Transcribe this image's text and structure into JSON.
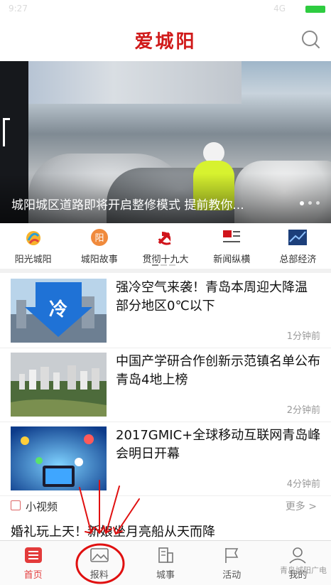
{
  "status_bar": {
    "time": "9:27",
    "network": "4G"
  },
  "header": {
    "title": "爱城阳"
  },
  "banner": {
    "caption": "城阳城区道路即将开启整修模式 提前教你...",
    "dots": 3,
    "active_dot": 0
  },
  "categories": [
    {
      "label": "阳光城阳",
      "icon": "sunshine-logo-icon"
    },
    {
      "label": "城阳故事",
      "icon": "story-badge-icon"
    },
    {
      "label": "贯彻十九大",
      "icon": "party-emblem-icon"
    },
    {
      "label": "新闻纵横",
      "icon": "news-flag-icon"
    },
    {
      "label": "总部经济",
      "icon": "economy-logo-icon"
    }
  ],
  "news": [
    {
      "title": "强冷空气来袭！青岛本周迎大降温 部分地区0℃以下",
      "time": "1分钟前",
      "thumb_text": "冷"
    },
    {
      "title": "中国产学研合作创新示范镇名单公布 青岛4地上榜",
      "time": "2分钟前"
    },
    {
      "title": "2017GMIC+全球移动互联网青岛峰会明日开幕",
      "time": "4分钟前"
    }
  ],
  "video_section": {
    "label": "小视频",
    "more": "更多 >",
    "first_title": "婚礼玩上天！新娘坐月亮船从天而降"
  },
  "tabbar": [
    {
      "label": "首页",
      "icon": "home-icon",
      "active": true
    },
    {
      "label": "报料",
      "icon": "report-image-icon",
      "active": false
    },
    {
      "label": "城事",
      "icon": "city-building-icon",
      "active": false
    },
    {
      "label": "活动",
      "icon": "flag-icon",
      "active": false
    },
    {
      "label": "我的",
      "icon": "person-icon",
      "active": false
    }
  ],
  "watermark": "青岛城阳广电",
  "colors": {
    "brand_red": "#d01a1a",
    "active_tab": "#e33b3b",
    "annotation_red": "#e01010"
  }
}
